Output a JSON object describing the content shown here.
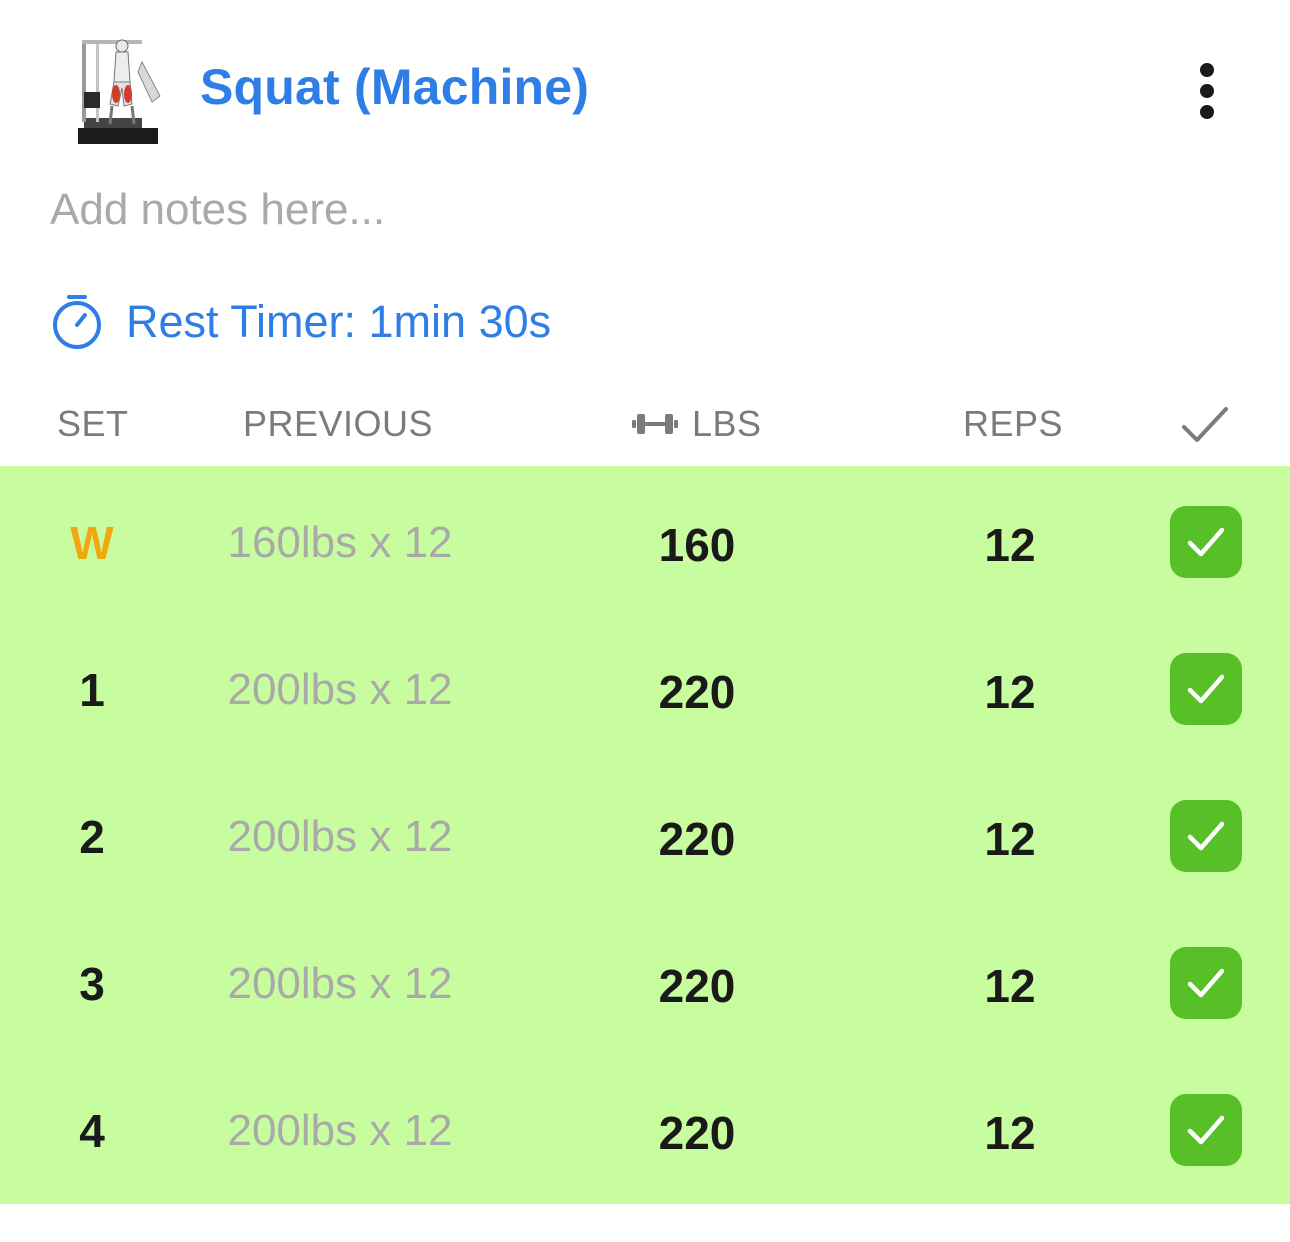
{
  "exercise": {
    "title": "Squat (Machine)",
    "thumbnail_icon": "squat-machine-illustration"
  },
  "notes": {
    "placeholder": "Add notes here...",
    "value": ""
  },
  "rest_timer": {
    "label": "Rest Timer: 1min 30s"
  },
  "columns": {
    "set": "SET",
    "previous": "PREVIOUS",
    "lbs": "LBS",
    "reps": "REPS"
  },
  "rows": [
    {
      "set": "W",
      "previous": "160lbs x 12",
      "lbs": "160",
      "reps": "12",
      "completed": true
    },
    {
      "set": "1",
      "previous": "200lbs x 12",
      "lbs": "220",
      "reps": "12",
      "completed": true
    },
    {
      "set": "2",
      "previous": "200lbs x 12",
      "lbs": "220",
      "reps": "12",
      "completed": true
    },
    {
      "set": "3",
      "previous": "200lbs x 12",
      "lbs": "220",
      "reps": "12",
      "completed": true
    },
    {
      "set": "4",
      "previous": "200lbs x 12",
      "lbs": "220",
      "reps": "12",
      "completed": true
    }
  ],
  "colors": {
    "accent": "#2f7ee6",
    "completed_row": "#c8fd9f",
    "check_green": "#57c027",
    "warmup": "#f0a810"
  }
}
